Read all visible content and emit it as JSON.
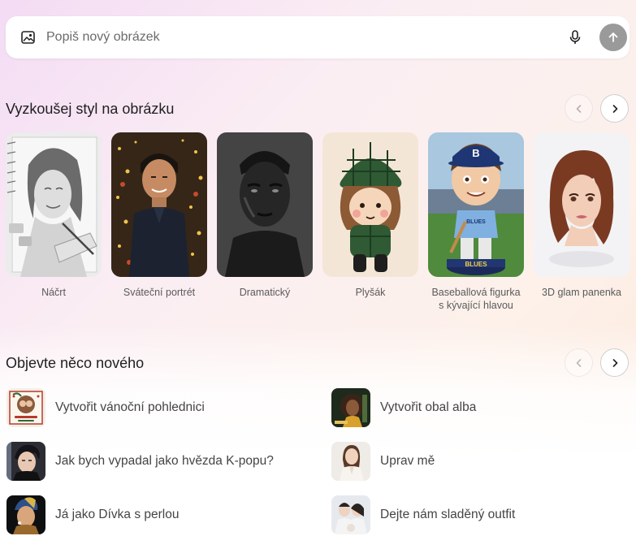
{
  "prompt": {
    "placeholder": "Popiš nový obrázek"
  },
  "styles_section": {
    "title": "Vyzkoušej styl na obrázku",
    "cards": [
      {
        "label": "Náčrt"
      },
      {
        "label": "Sváteční portrét"
      },
      {
        "label": "Dramatický"
      },
      {
        "label": "Plyšák"
      },
      {
        "label": "Baseballová figurka s kývající hlavou",
        "badge": "B",
        "jersey": "BLUES",
        "base": "BLUES"
      },
      {
        "label": "3D glam panenka"
      }
    ]
  },
  "discover_section": {
    "title": "Objevte něco nového",
    "items": [
      {
        "label": "Vytvořit vánoční pohlednici"
      },
      {
        "label": "Vytvořit obal alba"
      },
      {
        "label": "Jak bych vypadal jako hvězda K-popu?"
      },
      {
        "label": "Uprav mě"
      },
      {
        "label": "Já jako Dívka s perlou"
      },
      {
        "label": "Dejte nám sladěný outfit"
      }
    ]
  },
  "colors": {
    "send_button": "#9a9a9a",
    "text_primary": "#1f1f1f",
    "text_secondary": "#5a5a5a"
  }
}
